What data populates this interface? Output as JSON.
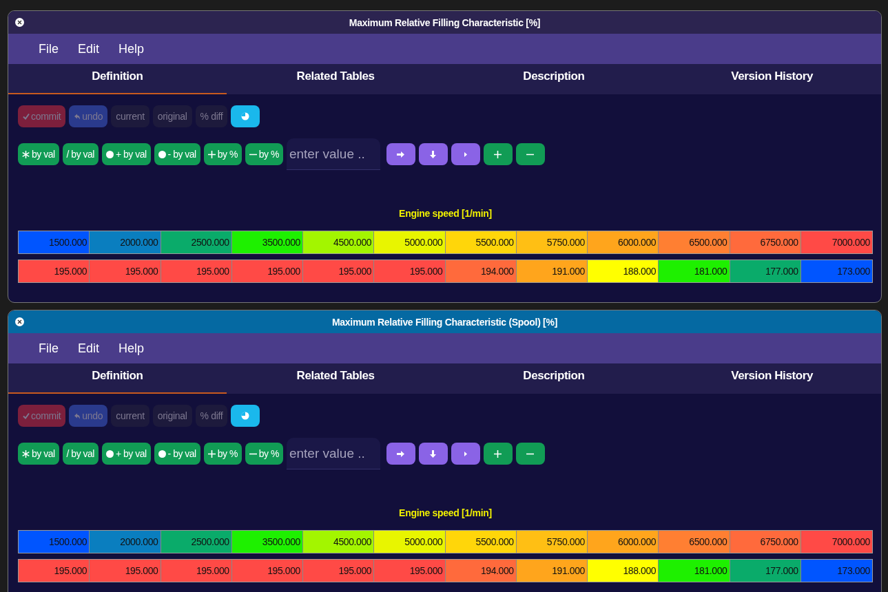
{
  "windows": [
    {
      "title": "Maximum Relative Filling Characteristic [%]",
      "focused": false,
      "menu": [
        "File",
        "Edit",
        "Help"
      ],
      "tabs": [
        {
          "label": "Definition",
          "selected": true
        },
        {
          "label": "Related Tables",
          "selected": false
        },
        {
          "label": "Description",
          "selected": false
        },
        {
          "label": "Version History",
          "selected": false
        }
      ],
      "toolbar": [
        {
          "kind": "commit",
          "label": "commit",
          "disabled": true
        },
        {
          "kind": "undo",
          "label": "undo",
          "disabled": true
        },
        {
          "kind": "plain",
          "label": "current",
          "disabled": true
        },
        {
          "kind": "plain",
          "label": "original",
          "disabled": true
        },
        {
          "kind": "plain",
          "label": "% diff",
          "disabled": true
        },
        {
          "kind": "refresh",
          "disabled": false
        }
      ],
      "operations": [
        {
          "kind": "asterisk",
          "label": "by val"
        },
        {
          "kind": "none",
          "label": "/ by val"
        },
        {
          "kind": "circle",
          "label": "+ by val"
        },
        {
          "kind": "circle",
          "label": "- by val"
        },
        {
          "kind": "plus",
          "label": "by %"
        },
        {
          "kind": "minus",
          "label": "by %"
        }
      ],
      "value_field": {
        "placeholder": "enter value .."
      },
      "nav_buttons": [
        {
          "kind": "arrow-right"
        },
        {
          "kind": "arrow-down"
        },
        {
          "kind": "caret-right"
        },
        {
          "kind": "plus"
        },
        {
          "kind": "minus"
        }
      ],
      "axis_label": "Engine speed [1/min]",
      "x_row": [
        {
          "value": "1500.000",
          "color": "#0055ff"
        },
        {
          "value": "2000.000",
          "color": "#0a7ebf"
        },
        {
          "value": "2500.000",
          "color": "#0aab6a"
        },
        {
          "value": "3500.000",
          "color": "#1ef000"
        },
        {
          "value": "4500.000",
          "color": "#a3f500"
        },
        {
          "value": "5000.000",
          "color": "#e8f500"
        },
        {
          "value": "5500.000",
          "color": "#ffd60a"
        },
        {
          "value": "5750.000",
          "color": "#ffbf14"
        },
        {
          "value": "6000.000",
          "color": "#ffa51c"
        },
        {
          "value": "6500.000",
          "color": "#ff7f32"
        },
        {
          "value": "6750.000",
          "color": "#ff6a3c"
        },
        {
          "value": "7000.000",
          "color": "#ff4a46"
        }
      ],
      "y_row": [
        {
          "value": "195.000",
          "color": "#ff4a46"
        },
        {
          "value": "195.000",
          "color": "#ff4a46"
        },
        {
          "value": "195.000",
          "color": "#ff4a46"
        },
        {
          "value": "195.000",
          "color": "#ff4a46"
        },
        {
          "value": "195.000",
          "color": "#ff4a46"
        },
        {
          "value": "195.000",
          "color": "#ff4a46"
        },
        {
          "value": "194.000",
          "color": "#ff6a3c"
        },
        {
          "value": "191.000",
          "color": "#ffa51c"
        },
        {
          "value": "188.000",
          "color": "#ffff00"
        },
        {
          "value": "181.000",
          "color": "#1ef000"
        },
        {
          "value": "177.000",
          "color": "#0aab6a"
        },
        {
          "value": "173.000",
          "color": "#0055ff"
        }
      ]
    },
    {
      "title": "Maximum Relative Filling Characteristic (Spool) [%]",
      "focused": true,
      "menu": [
        "File",
        "Edit",
        "Help"
      ],
      "tabs": [
        {
          "label": "Definition",
          "selected": true
        },
        {
          "label": "Related Tables",
          "selected": false
        },
        {
          "label": "Description",
          "selected": false
        },
        {
          "label": "Version History",
          "selected": false
        }
      ],
      "toolbar": [
        {
          "kind": "commit",
          "label": "commit",
          "disabled": true
        },
        {
          "kind": "undo",
          "label": "undo",
          "disabled": true
        },
        {
          "kind": "plain",
          "label": "current",
          "disabled": true
        },
        {
          "kind": "plain",
          "label": "original",
          "disabled": true
        },
        {
          "kind": "plain",
          "label": "% diff",
          "disabled": true
        },
        {
          "kind": "refresh",
          "disabled": false
        }
      ],
      "operations": [
        {
          "kind": "asterisk",
          "label": "by val"
        },
        {
          "kind": "none",
          "label": "/ by val"
        },
        {
          "kind": "circle",
          "label": "+ by val"
        },
        {
          "kind": "circle",
          "label": "- by val"
        },
        {
          "kind": "plus",
          "label": "by %"
        },
        {
          "kind": "minus",
          "label": "by %"
        }
      ],
      "value_field": {
        "placeholder": "enter value .."
      },
      "nav_buttons": [
        {
          "kind": "arrow-right"
        },
        {
          "kind": "arrow-down"
        },
        {
          "kind": "caret-right"
        },
        {
          "kind": "plus"
        },
        {
          "kind": "minus"
        }
      ],
      "axis_label": "Engine speed [1/min]",
      "x_row": [
        {
          "value": "1500.000",
          "color": "#0055ff"
        },
        {
          "value": "2000.000",
          "color": "#0a7ebf"
        },
        {
          "value": "2500.000",
          "color": "#0aab6a"
        },
        {
          "value": "3500.000",
          "color": "#1ef000"
        },
        {
          "value": "4500.000",
          "color": "#a3f500"
        },
        {
          "value": "5000.000",
          "color": "#e8f500"
        },
        {
          "value": "5500.000",
          "color": "#ffd60a"
        },
        {
          "value": "5750.000",
          "color": "#ffbf14"
        },
        {
          "value": "6000.000",
          "color": "#ffa51c"
        },
        {
          "value": "6500.000",
          "color": "#ff7f32"
        },
        {
          "value": "6750.000",
          "color": "#ff6a3c"
        },
        {
          "value": "7000.000",
          "color": "#ff4a46"
        }
      ],
      "y_row": [
        {
          "value": "195.000",
          "color": "#ff4a46"
        },
        {
          "value": "195.000",
          "color": "#ff4a46"
        },
        {
          "value": "195.000",
          "color": "#ff4a46"
        },
        {
          "value": "195.000",
          "color": "#ff4a46"
        },
        {
          "value": "195.000",
          "color": "#ff4a46"
        },
        {
          "value": "195.000",
          "color": "#ff4a46"
        },
        {
          "value": "194.000",
          "color": "#ff6a3c"
        },
        {
          "value": "191.000",
          "color": "#ffa51c"
        },
        {
          "value": "188.000",
          "color": "#ffff00"
        },
        {
          "value": "181.000",
          "color": "#1ef000"
        },
        {
          "value": "177.000",
          "color": "#0aab6a"
        },
        {
          "value": "173.000",
          "color": "#0055ff"
        }
      ]
    }
  ]
}
